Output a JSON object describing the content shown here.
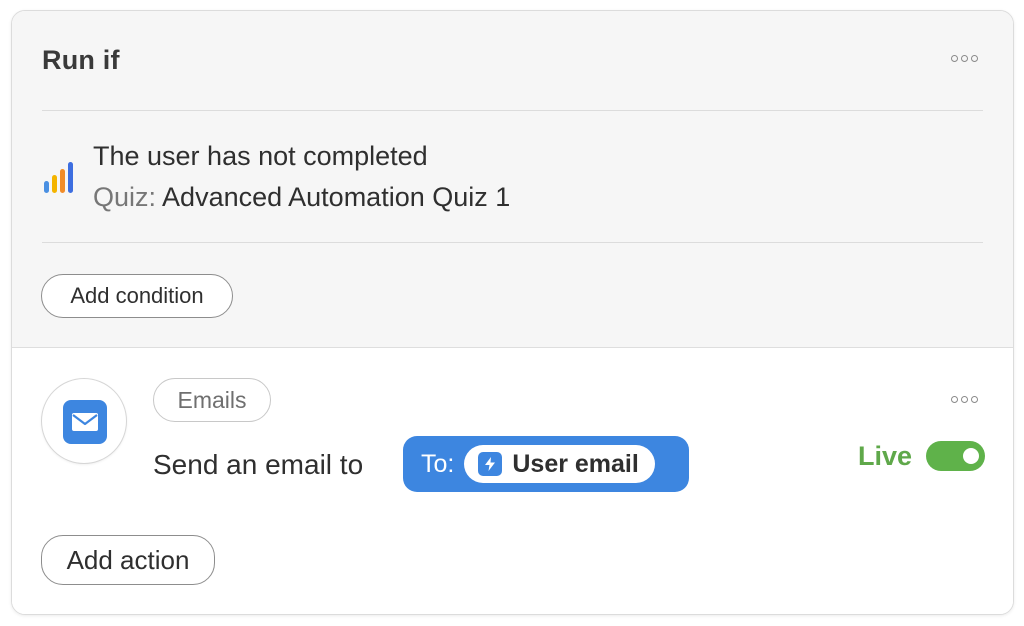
{
  "run_if": {
    "title": "Run if",
    "condition": {
      "line1": "The user has not completed",
      "label": "Quiz:",
      "value": "Advanced Automation Quiz 1",
      "icon": "bar-chart-icon"
    },
    "add_condition_label": "Add condition"
  },
  "action": {
    "category": "Emails",
    "text": "Send an email to",
    "to_label": "To:",
    "recipient": "User email",
    "recipient_icon": "lightning-icon",
    "action_icon": "envelope-icon",
    "status_label": "Live",
    "status_on": true,
    "add_action_label": "Add action"
  },
  "colors": {
    "accent_blue": "#3d86e0",
    "live_green": "#5fa84a",
    "chart_yellow": "#f4b400",
    "chart_orange": "#f28c28"
  }
}
